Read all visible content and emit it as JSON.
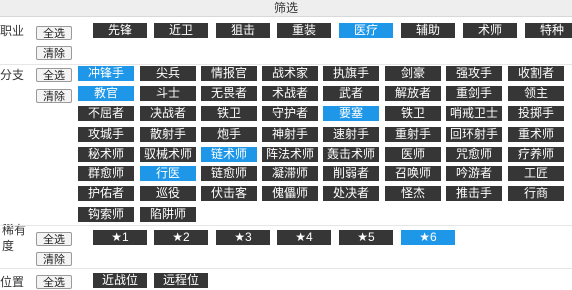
{
  "title": "筛选",
  "controls": {
    "select_all": "全选",
    "clear": "清除"
  },
  "colors": {
    "tag_bg": "#363636",
    "tag_selected": "#1e97e8",
    "text_on_tag": "#ffffff"
  },
  "sections": {
    "profession": {
      "label": "职业",
      "tags": [
        {
          "text": "先锋",
          "selected": false
        },
        {
          "text": "近卫",
          "selected": false
        },
        {
          "text": "狙击",
          "selected": false
        },
        {
          "text": "重装",
          "selected": false
        },
        {
          "text": "医疗",
          "selected": true
        },
        {
          "text": "辅助",
          "selected": false
        },
        {
          "text": "术师",
          "selected": false
        },
        {
          "text": "特种",
          "selected": false
        }
      ]
    },
    "branch": {
      "label": "分支",
      "tags": [
        {
          "text": "冲锋手",
          "selected": true
        },
        {
          "text": "尖兵",
          "selected": false
        },
        {
          "text": "情报官",
          "selected": false
        },
        {
          "text": "战术家",
          "selected": false
        },
        {
          "text": "执旗手",
          "selected": false
        },
        {
          "text": "剑豪",
          "selected": false
        },
        {
          "text": "强攻手",
          "selected": false
        },
        {
          "text": "收割者",
          "selected": false
        },
        {
          "text": "教官",
          "selected": true
        },
        {
          "text": "斗士",
          "selected": false
        },
        {
          "text": "无畏者",
          "selected": false
        },
        {
          "text": "术战者",
          "selected": false
        },
        {
          "text": "武者",
          "selected": false
        },
        {
          "text": "解放者",
          "selected": false
        },
        {
          "text": "重剑手",
          "selected": false
        },
        {
          "text": "领主",
          "selected": false
        },
        {
          "text": "不屈者",
          "selected": false
        },
        {
          "text": "决战者",
          "selected": false
        },
        {
          "text": "铁卫",
          "selected": false
        },
        {
          "text": "守护者",
          "selected": false
        },
        {
          "text": "要塞",
          "selected": true
        },
        {
          "text": "铁卫",
          "selected": false
        },
        {
          "text": "哨戒卫士",
          "selected": false
        },
        {
          "text": "投掷手",
          "selected": false
        },
        {
          "text": "攻城手",
          "selected": false
        },
        {
          "text": "散射手",
          "selected": false
        },
        {
          "text": "炮手",
          "selected": false
        },
        {
          "text": "神射手",
          "selected": false
        },
        {
          "text": "速射手",
          "selected": false
        },
        {
          "text": "重射手",
          "selected": false
        },
        {
          "text": "回环射手",
          "selected": false
        },
        {
          "text": "重术师",
          "selected": false
        },
        {
          "text": "秘术师",
          "selected": false
        },
        {
          "text": "驭械术师",
          "selected": false
        },
        {
          "text": "链术师",
          "selected": true
        },
        {
          "text": "阵法术师",
          "selected": false
        },
        {
          "text": "轰击术师",
          "selected": false
        },
        {
          "text": "医师",
          "selected": false
        },
        {
          "text": "咒愈师",
          "selected": false
        },
        {
          "text": "疗养师",
          "selected": false
        },
        {
          "text": "群愈师",
          "selected": false
        },
        {
          "text": "行医",
          "selected": true
        },
        {
          "text": "链愈师",
          "selected": false
        },
        {
          "text": "凝滞师",
          "selected": false
        },
        {
          "text": "削弱者",
          "selected": false
        },
        {
          "text": "召唤师",
          "selected": false
        },
        {
          "text": "吟游者",
          "selected": false
        },
        {
          "text": "工匠",
          "selected": false
        },
        {
          "text": "护佑者",
          "selected": false
        },
        {
          "text": "巡役",
          "selected": false
        },
        {
          "text": "伏击客",
          "selected": false
        },
        {
          "text": "傀儡师",
          "selected": false
        },
        {
          "text": "处决者",
          "selected": false
        },
        {
          "text": "怪杰",
          "selected": false
        },
        {
          "text": "推击手",
          "selected": false
        },
        {
          "text": "行商",
          "selected": false
        },
        {
          "text": "钩索师",
          "selected": false
        },
        {
          "text": "陷阱师",
          "selected": false
        }
      ]
    },
    "rarity": {
      "label": "稀有度",
      "tags": [
        {
          "text": "★1",
          "selected": false
        },
        {
          "text": "★2",
          "selected": false
        },
        {
          "text": "★3",
          "selected": false
        },
        {
          "text": "★4",
          "selected": false
        },
        {
          "text": "★5",
          "selected": false
        },
        {
          "text": "★6",
          "selected": true
        }
      ]
    },
    "position": {
      "label": "位置",
      "tags": [
        {
          "text": "近战位",
          "selected": false
        },
        {
          "text": "远程位",
          "selected": false
        }
      ]
    }
  }
}
